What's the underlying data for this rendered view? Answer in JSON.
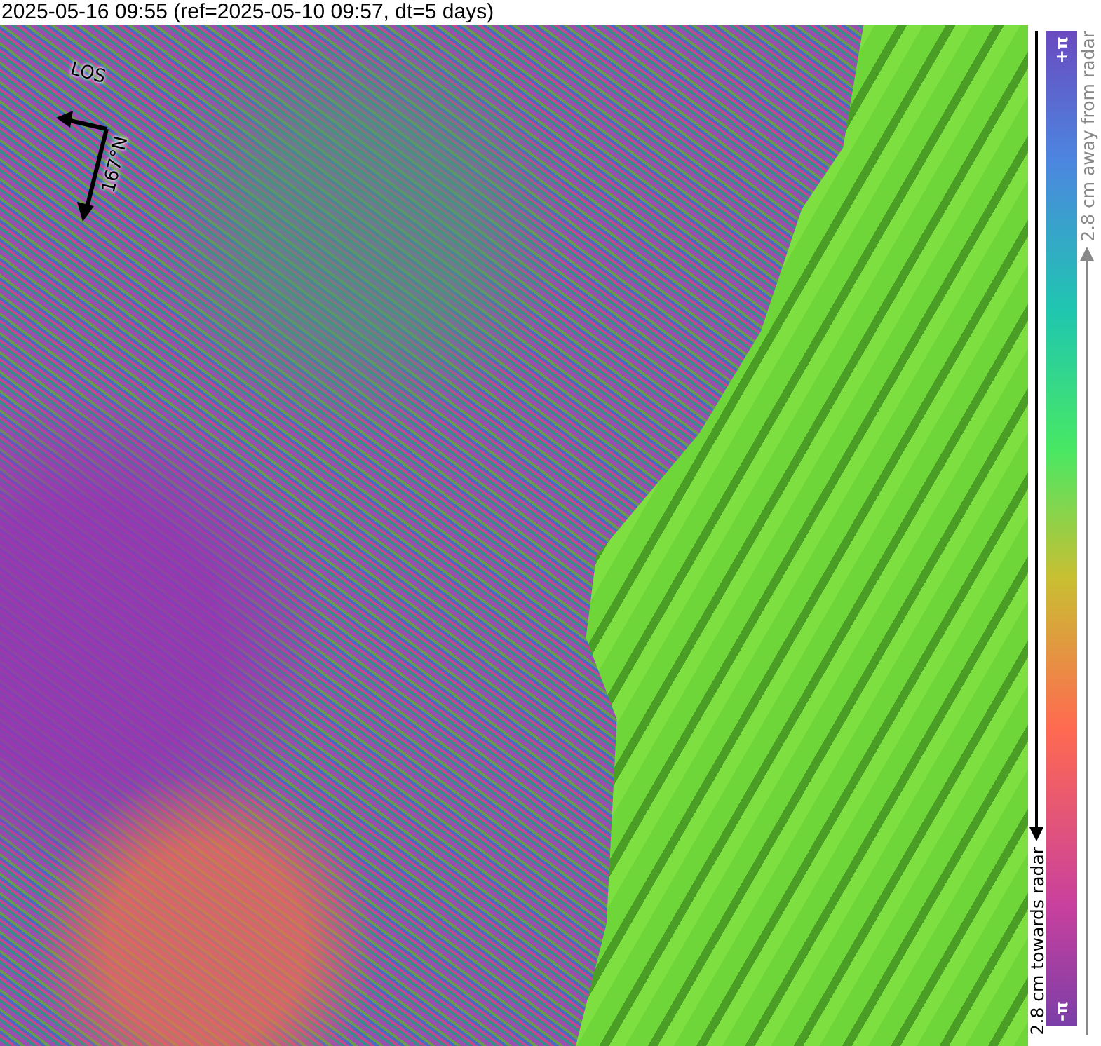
{
  "title": "2025-05-16 09:55 (ref=2025-05-10 09:57, dt=5 days)",
  "map": {
    "los_label": "LOS",
    "heading_label": "167°N"
  },
  "colorbar": {
    "top_label": "+π",
    "bottom_label": "-π",
    "towards_label": "2.8 cm towards radar",
    "away_label": "2.8 cm away from radar"
  }
}
